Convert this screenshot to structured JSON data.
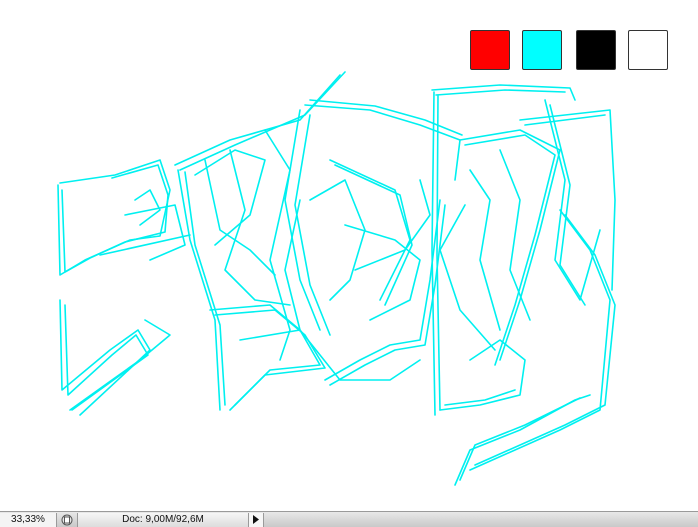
{
  "palette": {
    "swatches": [
      {
        "color": "#ff0000",
        "name": "red"
      },
      {
        "color": "#00ffff",
        "name": "cyan"
      },
      {
        "color": "#000000",
        "name": "black"
      },
      {
        "color": "#ffffff",
        "name": "white"
      }
    ],
    "stroke_color": "#00f0f0"
  },
  "status_bar": {
    "zoom": "33,33%",
    "doc_info": "Doc: 9,00M/92,6M",
    "status_icon": "document-status-icon",
    "menu_arrow_icon": "play-triangle-icon"
  }
}
